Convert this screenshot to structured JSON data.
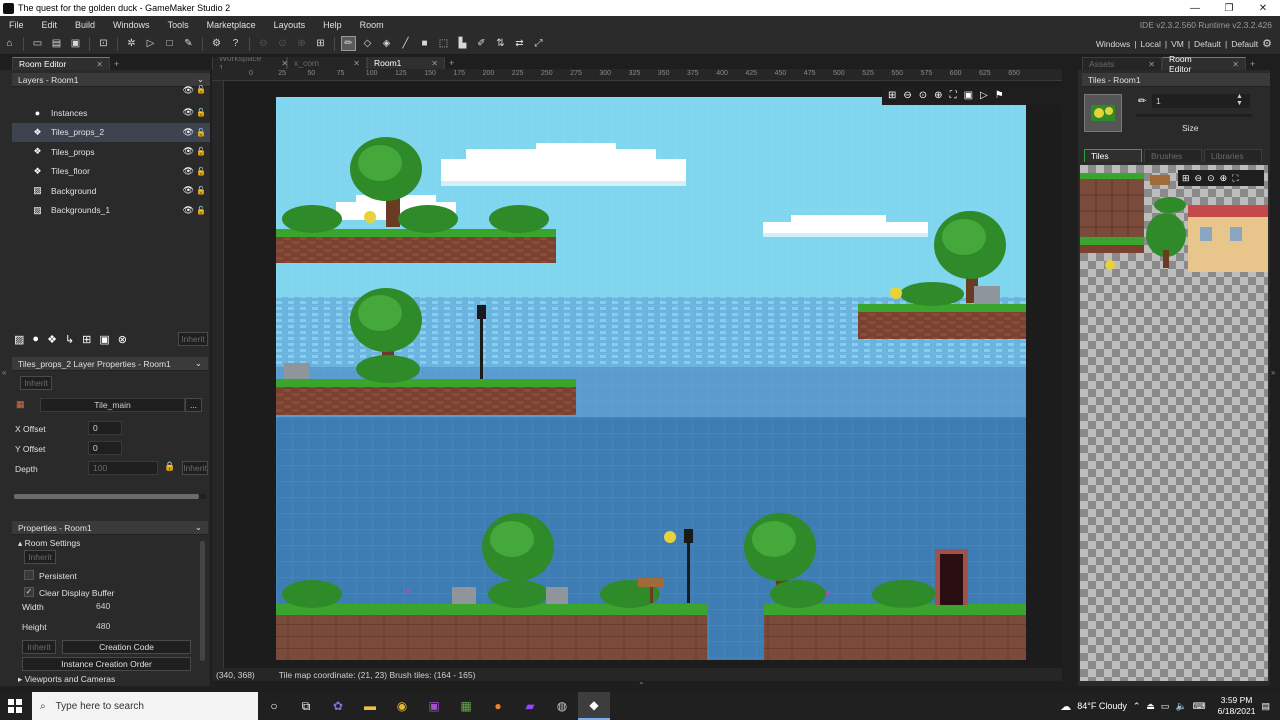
{
  "window": {
    "title": "The quest for the golden duck - GameMaker Studio 2",
    "controls": [
      "—",
      "❐",
      "✕"
    ]
  },
  "menu": {
    "items": [
      "File",
      "Edit",
      "Build",
      "Windows",
      "Tools",
      "Marketplace",
      "Layouts",
      "Help",
      "Room"
    ],
    "version": "IDE v2.3.2.560  Runtime v2.3.2.426"
  },
  "toolbar": {
    "targets": [
      "Windows",
      "Local",
      "VM",
      "Default",
      "Default"
    ]
  },
  "left_panel": {
    "tab_label": "Room Editor",
    "tab_plus": "+",
    "layers_header": "Layers - Room1",
    "layers": [
      {
        "name": "Instances",
        "icon": "instances-icon"
      },
      {
        "name": "Tiles_props_2",
        "icon": "tiles-icon",
        "selected": true
      },
      {
        "name": "Tiles_props",
        "icon": "tiles-icon"
      },
      {
        "name": "Tiles_floor",
        "icon": "tiles-icon"
      },
      {
        "name": "Background",
        "icon": "background-icon"
      },
      {
        "name": "Backgrounds_1",
        "icon": "background-icon"
      }
    ],
    "inherit_label": "Inherit",
    "layer_props_header": "Tiles_props_2 Layer Properties - Room1",
    "tileset_name": "Tile_main",
    "tileset_more": "...",
    "x_offset_label": "X Offset",
    "x_offset": "0",
    "y_offset_label": "Y Offset",
    "y_offset": "0",
    "depth_label": "Depth",
    "depth": "100",
    "properties_header": "Properties - Room1",
    "room_settings_label": "Room Settings",
    "persistent_label": "Persistent",
    "persistent": false,
    "clear_display_label": "Clear Display Buffer",
    "clear_display": true,
    "width_label": "Width",
    "width": "640",
    "height_label": "Height",
    "height": "480",
    "creation_code": "Creation Code",
    "instance_order": "Instance Creation Order",
    "viewports": "Viewports and Cameras"
  },
  "center": {
    "tabs": [
      {
        "label": "Workspace 1",
        "active": false
      },
      {
        "label": "x_com",
        "active": false
      },
      {
        "label": "Room1",
        "active": true
      }
    ],
    "ruler_ticks": [
      "0",
      "25",
      "50",
      "75",
      "100",
      "125",
      "150",
      "175",
      "200",
      "225",
      "250",
      "275",
      "300",
      "325",
      "350",
      "375",
      "400",
      "425",
      "450",
      "475",
      "500",
      "525",
      "550",
      "575",
      "600",
      "625",
      "650"
    ],
    "status_coords": "(340, 368)",
    "status_tilemap": "Tile map coordinate: (21, 23) Brush tiles: (164 - 165)"
  },
  "right_panel": {
    "tabs": [
      {
        "label": "Assets",
        "active": false
      },
      {
        "label": "Room Editor",
        "active": true
      }
    ],
    "tiles_header": "Tiles - Room1",
    "brush_value": "1",
    "size_label": "Size",
    "subtabs": [
      {
        "label": "Tiles",
        "active": true
      },
      {
        "label": "Brushes",
        "active": false
      },
      {
        "label": "Libraries",
        "active": false
      }
    ]
  },
  "taskbar": {
    "search_placeholder": "Type here to search",
    "weather": "84°F  Cloudy",
    "time": "3:59 PM",
    "date": "6/18/2021"
  },
  "colors": {
    "sky": "#7fd6ee",
    "sea": "#3a7fb6",
    "grass": "#3a9a2c",
    "dirt": "#6e3a2a",
    "accent_green": "#2ea43c"
  }
}
